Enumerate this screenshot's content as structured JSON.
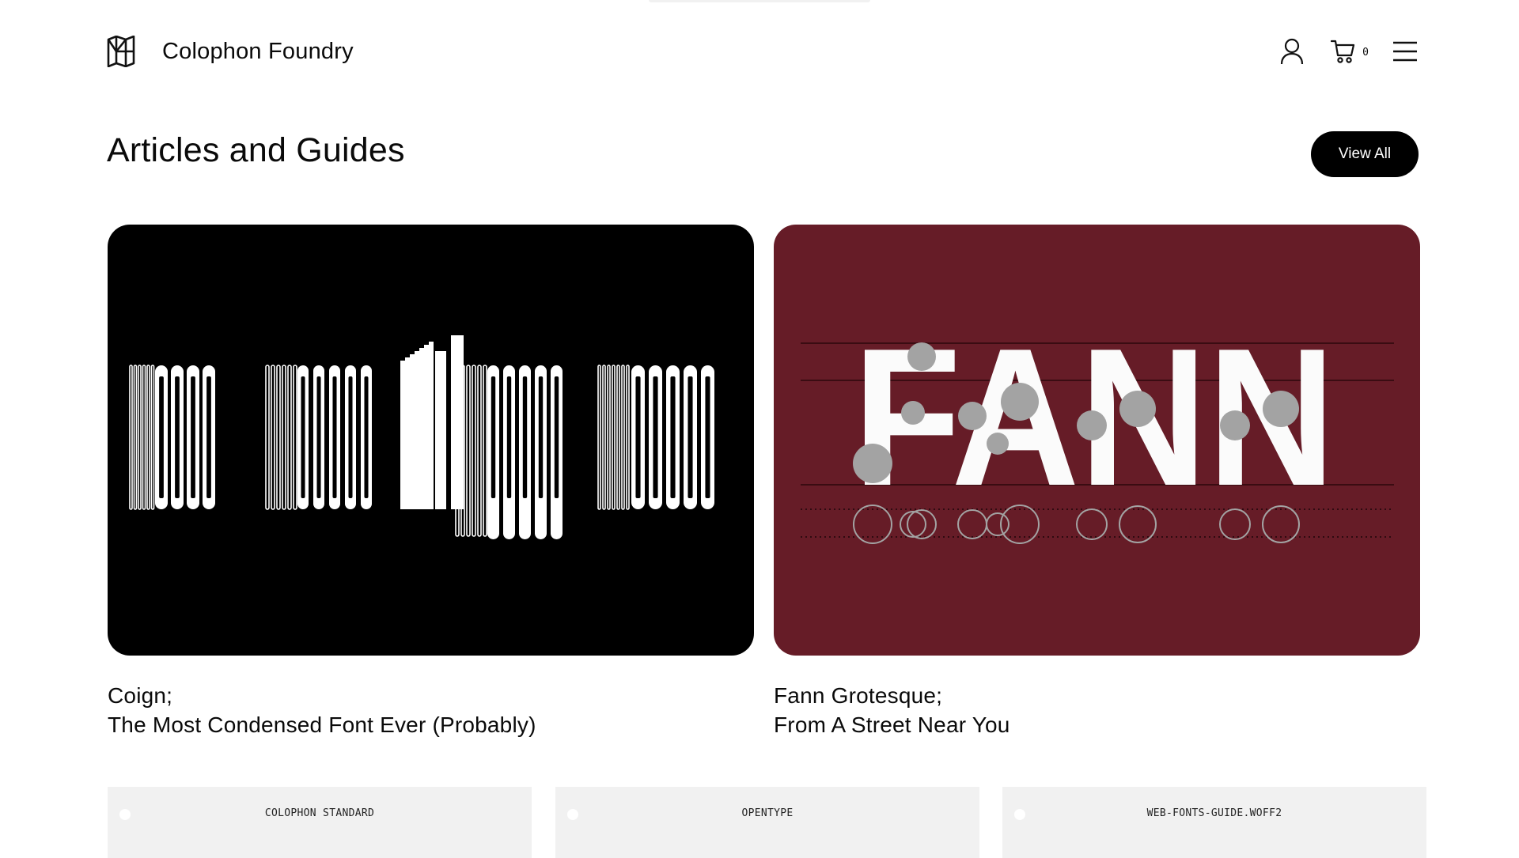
{
  "brand": {
    "name": "Colophon Foundry"
  },
  "header": {
    "cart_count": "0",
    "icons": [
      "account-icon",
      "cart-icon",
      "menu-icon"
    ]
  },
  "section": {
    "title": "Articles and Guides",
    "view_all_label": "View All"
  },
  "articles": [
    {
      "title_line1": "Coign;",
      "title_line2": "The Most Condensed Font Ever (Probably)",
      "image_bg": "#000000"
    },
    {
      "title_line1": "Fann Grotesque;",
      "title_line2": "From A Street Near You",
      "image_bg": "#661c27",
      "image_text": "FANN"
    }
  ],
  "tiles": [
    {
      "label": "COLOPHON STANDARD"
    },
    {
      "label": "OPENTYPE"
    },
    {
      "label": "WEB-FONTS-GUIDE.WOFF2"
    }
  ]
}
